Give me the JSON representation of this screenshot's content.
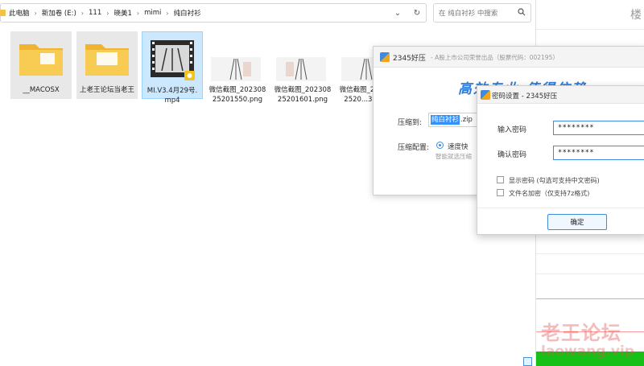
{
  "explorer": {
    "breadcrumbs": [
      "此电脑",
      "新加卷 (E:)",
      "111",
      "晓美1",
      "mimi",
      "纯白衬衫"
    ],
    "search_placeholder": "在 纯白衬衫 中搜索",
    "files": [
      {
        "name": "__MACOSX",
        "type": "folder"
      },
      {
        "name": "上老王论坛当老王",
        "type": "folder"
      },
      {
        "name": "MI.V3.4月29号.mp4",
        "type": "video",
        "selected": true
      },
      {
        "name": "微信截图_20230825201550.png",
        "type": "image"
      },
      {
        "name": "微信截图_20230825201601.png",
        "type": "image"
      },
      {
        "name": "微信截图_2023082520...38.png",
        "type": "image"
      }
    ]
  },
  "compress_window": {
    "title": "2345好压",
    "subtitle": "- A股上市公司荣誉出品（股票代码：002195）",
    "slogan": "高效专业 值得信赖",
    "compress_to_label": "压缩到:",
    "filename_selected": "纯白衬衫",
    "filename_ext": ".zip",
    "config_label": "压缩配置:",
    "option_fast": "速度快",
    "smart_text": "智能就选压缩"
  },
  "password_dialog": {
    "title": "密码设置 - 2345好压",
    "enter_label": "输入密码",
    "confirm_label": "确认密码",
    "enter_value": "********",
    "confirm_value": "********",
    "show_password": "显示密码 (勾选可支持中文密码)",
    "encrypt_names": "文件名加密（仅支持7z格式)",
    "ok": "确定"
  },
  "background_page": {
    "title_char": "楼",
    "watermark_cn": "老王论坛",
    "watermark_en": "laowang.vip"
  },
  "colors": {
    "accent": "#3d8be0",
    "selection": "#cce8ff",
    "folder": "#f5c342",
    "green": "#16c016"
  }
}
